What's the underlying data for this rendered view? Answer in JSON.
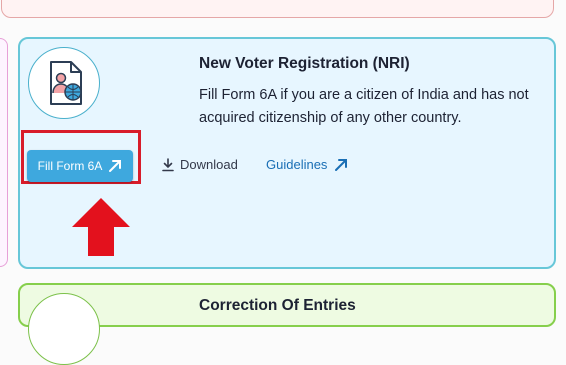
{
  "nri_card": {
    "title": "New Voter Registration (NRI)",
    "description": "Fill Form 6A if you are a citizen of India and has not acquired citizenship of any other country.",
    "fill_button_label": "Fill Form 6A",
    "download_label": "Download",
    "guidelines_label": "Guidelines"
  },
  "next_card": {
    "title": "Correction Of Entries"
  },
  "colors": {
    "card_border": "#67c7d8",
    "card_background": "#e7f6ff",
    "button_blue": "#3ea8de",
    "highlight_red": "#d81c2a",
    "link_blue": "#1a6fb5",
    "next_card_border": "#86cf4c"
  },
  "icons": {
    "document": "voter-document-globe-icon",
    "fill_button": "arrow-up-right-icon",
    "download": "download-icon",
    "guidelines": "arrow-up-right-icon",
    "annotation": "red-up-arrow"
  }
}
